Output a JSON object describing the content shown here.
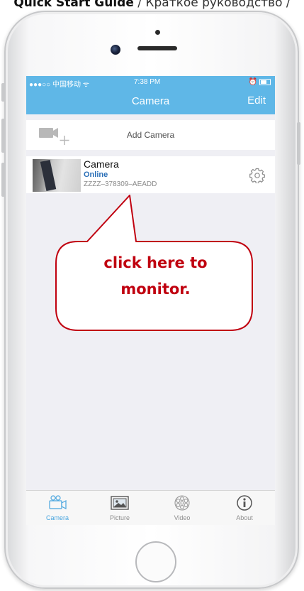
{
  "header": {
    "guide_title": "Quick Start Guide",
    "guide_sub": " / Краткое руководство / "
  },
  "status_bar": {
    "carrier": "●●●○○ 中国移动 ᯤ",
    "time": "7:38 PM"
  },
  "nav": {
    "title": "Camera",
    "edit_label": "Edit"
  },
  "add_camera": {
    "label": "Add Camera"
  },
  "camera_item": {
    "name": "Camera",
    "status": "Online",
    "uid": "ZZZZ–378309–AEADD"
  },
  "tabs": [
    {
      "label": "Camera",
      "icon": "camera-tab-icon",
      "active": true
    },
    {
      "label": "Picture",
      "icon": "picture-tab-icon",
      "active": false
    },
    {
      "label": "Video",
      "icon": "video-tab-icon",
      "active": false
    },
    {
      "label": "About",
      "icon": "info-tab-icon",
      "active": false
    }
  ],
  "callout": {
    "line1": "click here to",
    "line2": "monitor."
  },
  "colors": {
    "nav_blue": "#5fb7e7",
    "online_blue": "#2a6fb7",
    "callout_red": "#c0000f",
    "tab_active": "#4aa6df"
  }
}
